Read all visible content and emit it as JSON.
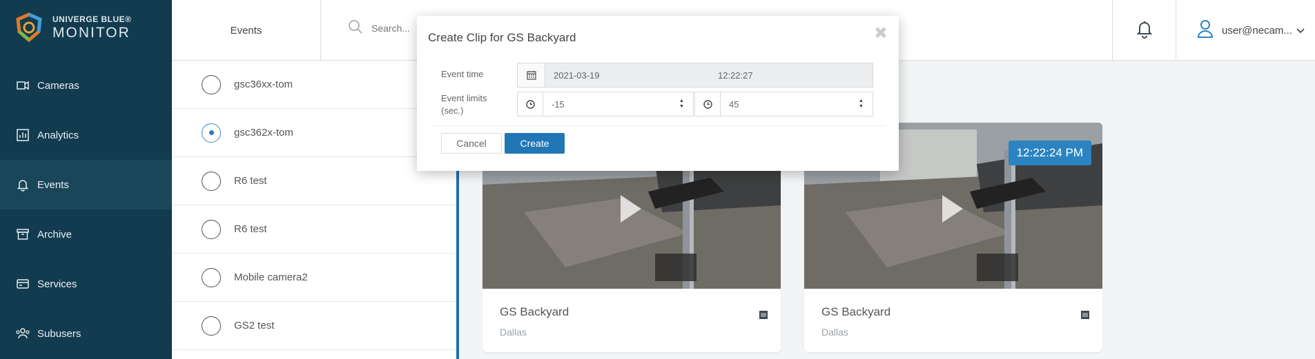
{
  "brand": {
    "line1": "UNIVERGE BLUE®",
    "line2": "MONITOR"
  },
  "sidebar": {
    "items": [
      {
        "label": "Cameras",
        "icon": "camera-icon"
      },
      {
        "label": "Analytics",
        "icon": "analytics-icon"
      },
      {
        "label": "Events",
        "icon": "bell-icon",
        "active": true
      },
      {
        "label": "Archive",
        "icon": "archive-icon"
      },
      {
        "label": "Services",
        "icon": "services-icon"
      },
      {
        "label": "Subusers",
        "icon": "subusers-icon"
      }
    ]
  },
  "header": {
    "section_title": "Events",
    "search_placeholder": "Search...",
    "user_name": "user@necam..."
  },
  "camera_list": [
    {
      "label": "gsc36xx-tom",
      "selected": false
    },
    {
      "label": "gsc362x-tom",
      "selected": true
    },
    {
      "label": "R6 test",
      "selected": false
    },
    {
      "label": "R6 test",
      "selected": false
    },
    {
      "label": "Mobile camera2",
      "selected": false
    },
    {
      "label": "GS2 test",
      "selected": false
    }
  ],
  "cards": [
    {
      "title": "GS Backyard",
      "location": "Dallas"
    },
    {
      "title": "GS Backyard",
      "location": "Dallas",
      "time": "12:22:24 PM"
    }
  ],
  "modal": {
    "title": "Create Clip for GS Backyard",
    "event_time_label": "Event time",
    "event_date": "2021-03-19",
    "event_time": "12:22:27",
    "event_limits_label": "Event limits (sec.)",
    "limit_before": "-15",
    "limit_after": "45",
    "cancel_label": "Cancel",
    "create_label": "Create"
  },
  "colors": {
    "sidebar_bg": "#123b4f",
    "accent": "#2177b6"
  }
}
